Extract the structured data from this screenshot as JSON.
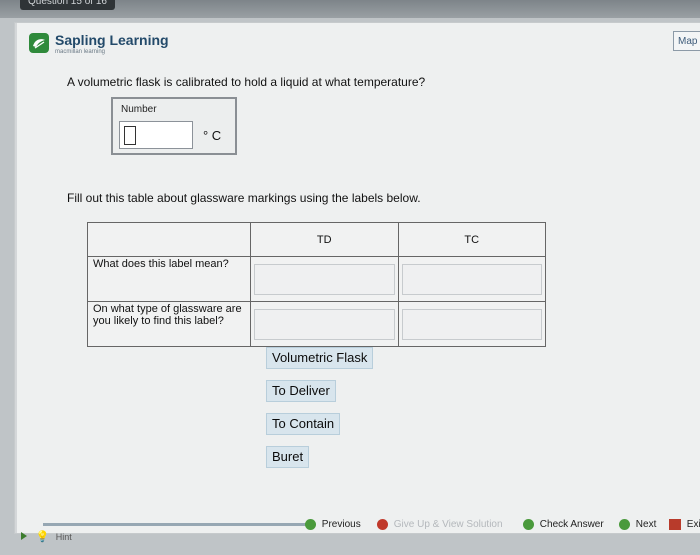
{
  "header": {
    "question_counter": "Question 15 of 16",
    "brand_name": "Sapling Learning",
    "brand_sub": "macmillan learning",
    "map_label": "Map"
  },
  "question": {
    "text": "A volumetric flask is calibrated to hold a liquid at what temperature?",
    "number_label": "Number",
    "input_value": "",
    "unit": "° C"
  },
  "table_section": {
    "instructions": "Fill out this table about glassware markings using the labels below.",
    "columns": [
      "TD",
      "TC"
    ],
    "rows": [
      "What does this label mean?",
      "On what type of glassware are you likely to find this label?"
    ]
  },
  "labels": [
    "Volumetric Flask",
    "To Deliver",
    "To Contain",
    "Buret"
  ],
  "footer": {
    "hint": "Hint",
    "previous": "Previous",
    "give_up": "Give Up & View Solution",
    "check_answer": "Check Answer",
    "next": "Next",
    "exit": "Exit"
  },
  "colors": {
    "brand_green": "#2f8a3b",
    "chip_bg": "#d8e5ed",
    "nav_green": "#4a9a3c",
    "give_up_red": "#c0392b"
  }
}
